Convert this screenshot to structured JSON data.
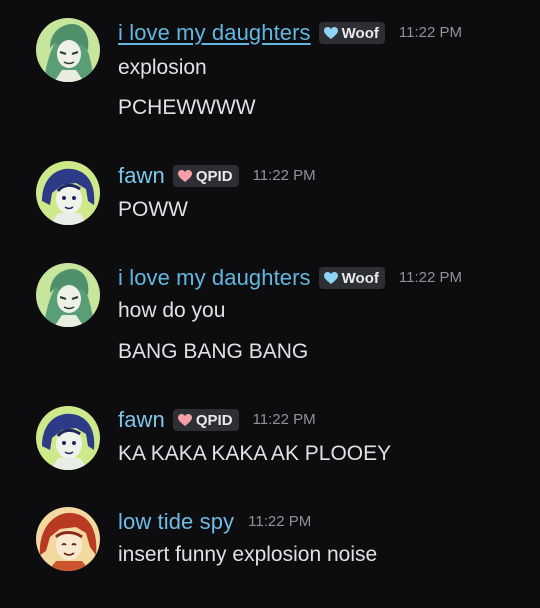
{
  "colors": {
    "background": "#0d0d10",
    "name_daughters": "#62b7e0",
    "name_fawn": "#7cc7ea",
    "name_spy": "#6fbbe6",
    "tag_woof_heart": "#8fd3f5",
    "tag_qpid_heart": "#f5a0a8",
    "timestamp": "#8e9297"
  },
  "messages": [
    {
      "author": "i love my daughters",
      "tag": "Woof",
      "tag_icon": "blue-heart-icon",
      "time": "11:22 PM",
      "lines": [
        "explosion",
        "PCHEWWWW"
      ]
    },
    {
      "author": "fawn",
      "tag": "QPID",
      "tag_icon": "pink-heart-icon",
      "time": "11:22 PM",
      "lines": [
        "POWW"
      ]
    },
    {
      "author": "i love my daughters",
      "tag": "Woof",
      "tag_icon": "blue-heart-icon",
      "time": "11:22 PM",
      "lines": [
        "how do you",
        "BANG BANG BANG"
      ]
    },
    {
      "author": "fawn",
      "tag": "QPID",
      "tag_icon": "pink-heart-icon",
      "time": "11:22 PM",
      "lines": [
        "KA KAKA KAKA AK PLOOEY"
      ]
    },
    {
      "author": "low tide spy",
      "time": "11:22 PM",
      "lines": [
        "insert funny explosion noise"
      ]
    }
  ]
}
